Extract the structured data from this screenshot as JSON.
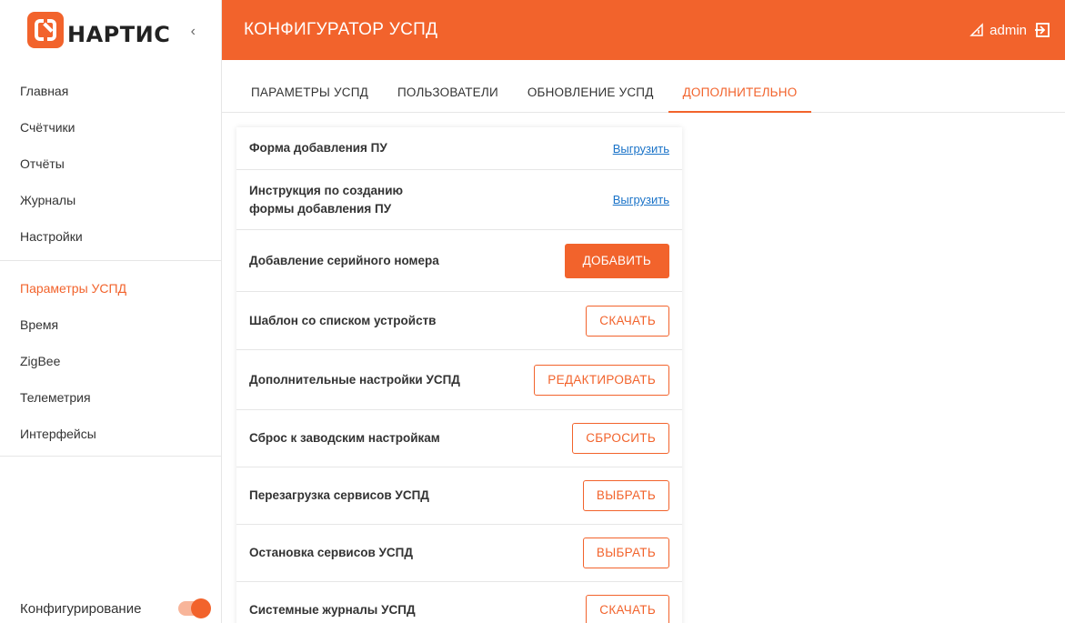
{
  "app": {
    "logo_text": "НАРТИС",
    "collapse_glyph": "‹",
    "header_title": "КОНФИГУРАТОР УСПД",
    "user": "admin",
    "accent_color": "#f2632c"
  },
  "sidebar": {
    "group1": [
      "Главная",
      "Счётчики",
      "Отчёты",
      "Журналы",
      "Настройки"
    ],
    "group2": [
      "Параметры УСПД",
      "Время",
      "ZigBee",
      "Телеметрия",
      "Интерфейсы"
    ],
    "active": "Параметры УСПД",
    "footer_label": "Конфигурирование",
    "footer_toggle_on": true
  },
  "tabs": [
    "ПАРАМЕТРЫ УСПД",
    "ПОЛЬЗОВАТЕЛИ",
    "ОБНОВЛЕНИЕ УСПД",
    "ДОПОЛНИТЕЛЬНО"
  ],
  "active_tab": "ДОПОЛНИТЕЛЬНО",
  "rows": [
    {
      "label": "Форма добавления ПУ",
      "action": "Выгрузить",
      "type": "link"
    },
    {
      "label": "Инструкция по созданию формы добавления ПУ",
      "action": "Выгрузить",
      "type": "link"
    },
    {
      "label": "Добавление серийного номера",
      "action": "ДОБАВИТЬ",
      "type": "primary"
    },
    {
      "label": "Шаблон со списком устройств",
      "action": "СКАЧАТЬ",
      "type": "outline"
    },
    {
      "label": "Дополнительные настройки УСПД",
      "action": "РЕДАКТИРОВАТЬ",
      "type": "outline"
    },
    {
      "label": "Сброс к заводским настройкам",
      "action": "СБРОСИТЬ",
      "type": "outline"
    },
    {
      "label": "Перезагрузка сервисов УСПД",
      "action": "ВЫБРАТЬ",
      "type": "outline"
    },
    {
      "label": "Остановка сервисов УСПД",
      "action": "ВЫБРАТЬ",
      "type": "outline"
    },
    {
      "label": "Системные журналы УСПД",
      "action": "СКАЧАТЬ",
      "type": "outline"
    }
  ]
}
